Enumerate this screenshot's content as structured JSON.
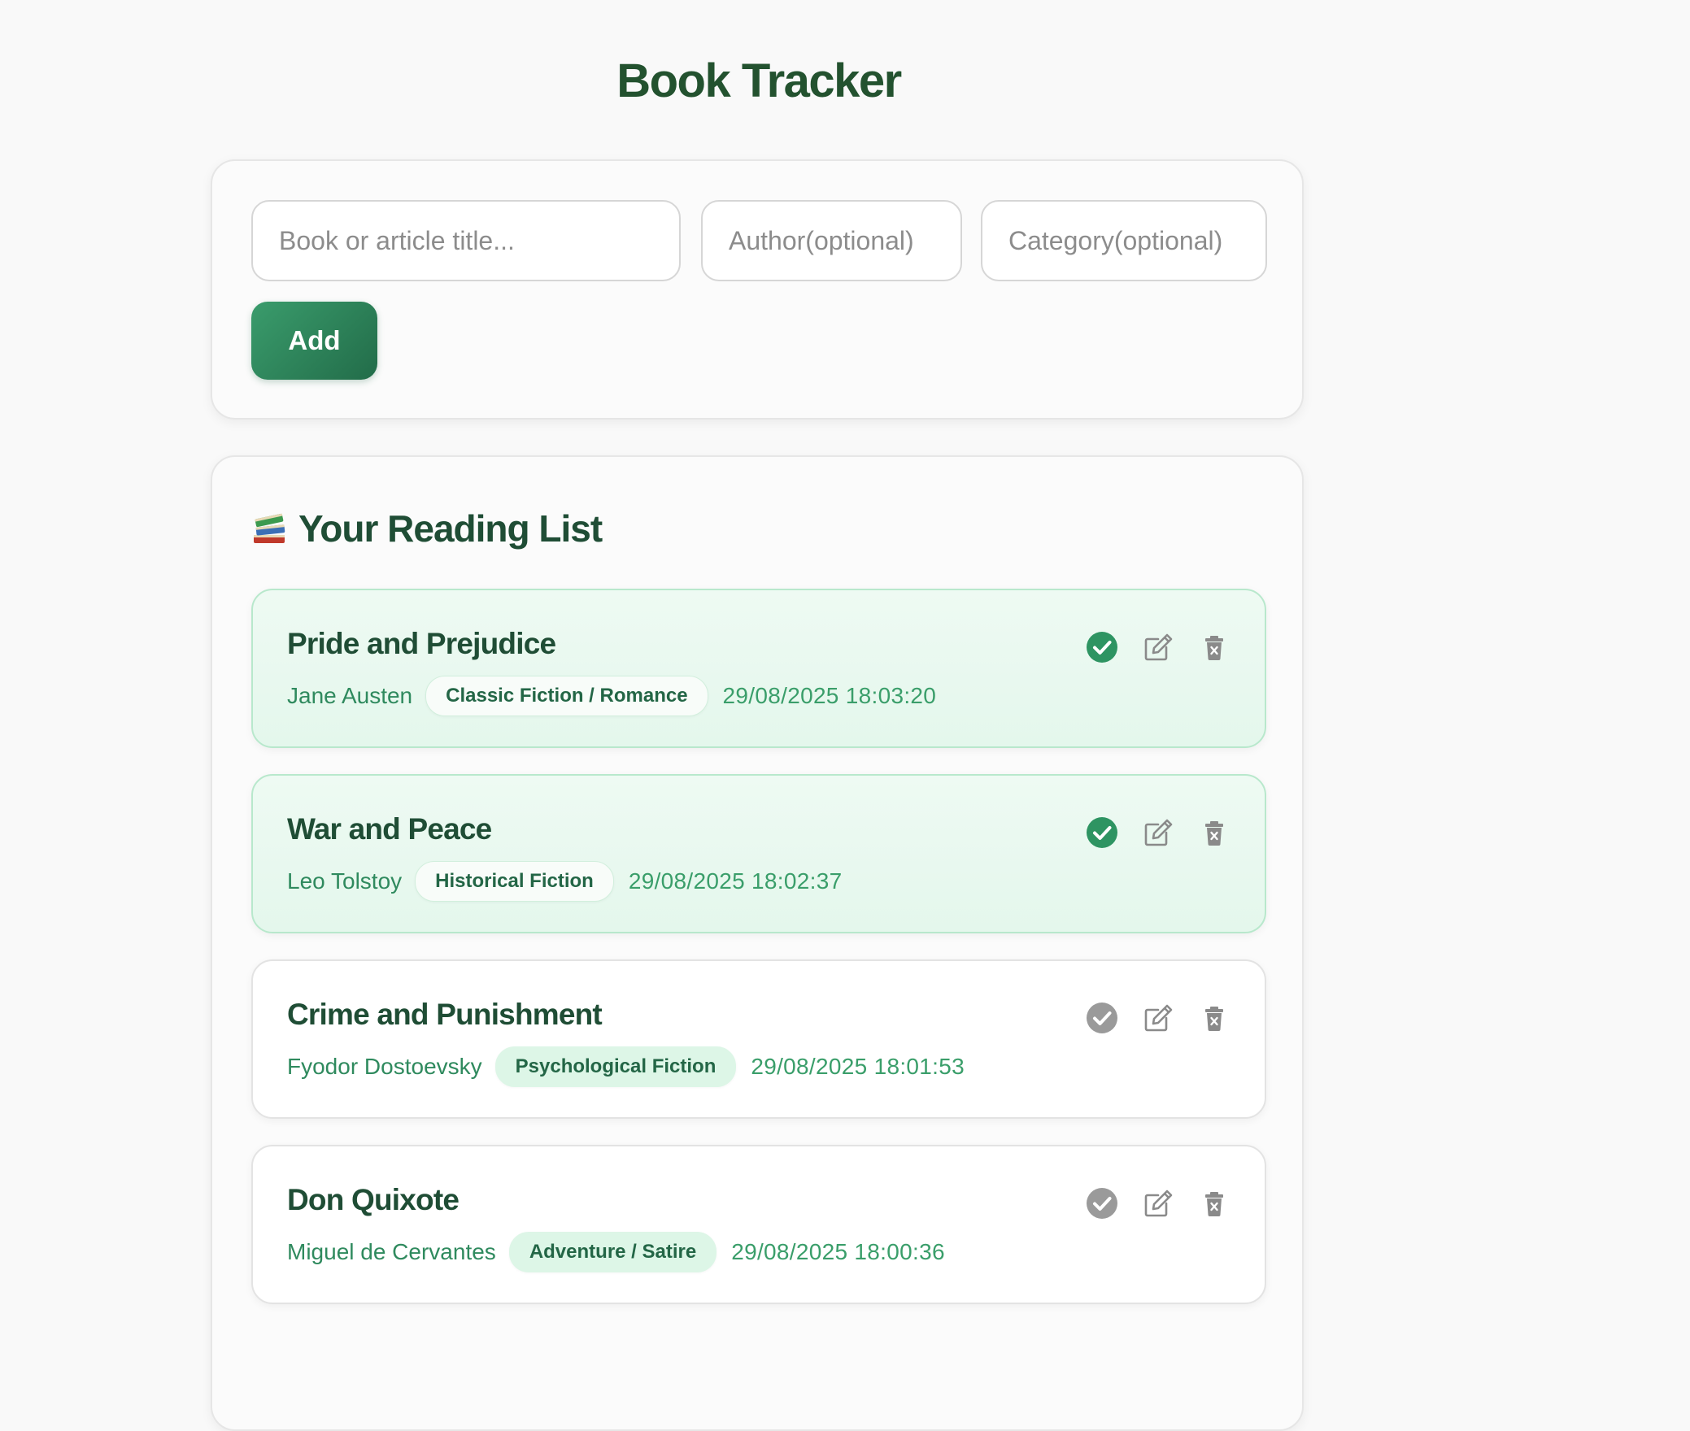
{
  "app": {
    "title": "Book Tracker"
  },
  "form": {
    "title_placeholder": "Book or article title...",
    "author_placeholder": "Author(optional)",
    "category_placeholder": "Category(optional)",
    "title_value": "",
    "author_value": "",
    "category_value": "",
    "add_label": "Add"
  },
  "reading_list": {
    "heading": "Your Reading List",
    "heading_icon": "books-emoji",
    "action_icons": [
      "check-circle-icon",
      "edit-icon",
      "trash-icon"
    ],
    "colors": {
      "done_check": "#2e9462",
      "pending_check": "#9a9a9a",
      "accent": "#2f8a5e",
      "title": "#1f4d35"
    },
    "books": [
      {
        "title": "Pride and Prejudice",
        "author": "Jane Austen",
        "category": "Classic Fiction / Romance",
        "added": "29/08/2025 18:03:20",
        "completed": true
      },
      {
        "title": "War and Peace",
        "author": "Leo Tolstoy",
        "category": "Historical Fiction",
        "added": "29/08/2025 18:02:37",
        "completed": true
      },
      {
        "title": "Crime and Punishment",
        "author": "Fyodor Dostoevsky",
        "category": "Psychological Fiction",
        "added": "29/08/2025 18:01:53",
        "completed": false
      },
      {
        "title": "Don Quixote",
        "author": "Miguel de Cervantes",
        "category": "Adventure / Satire",
        "added": "29/08/2025 18:00:36",
        "completed": false
      }
    ]
  }
}
